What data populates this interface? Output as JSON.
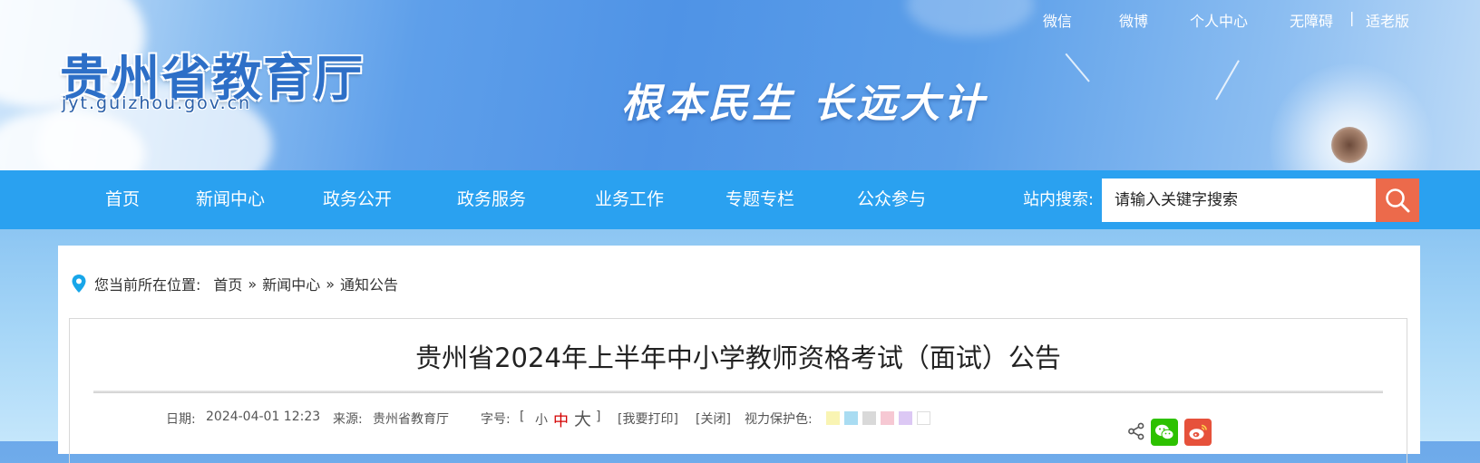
{
  "header": {
    "site_title": "贵州省教育厅",
    "site_url": "jyt.guizhou.gov.cn",
    "slogan": "根本民生 长远大计",
    "top_links": {
      "wechat": "微信",
      "weibo": "微博",
      "personal_center": "个人中心",
      "accessibility": "无障碍",
      "divider": "|",
      "elderly": "适老版"
    }
  },
  "nav": {
    "items": [
      "首页",
      "新闻中心",
      "政务公开",
      "政务服务",
      "业务工作",
      "专题专栏",
      "公众参与"
    ],
    "search_label": "站内搜索:",
    "search_placeholder": "请输入关键字搜索"
  },
  "breadcrumb": {
    "prefix": "您当前所在位置:",
    "items": [
      "首页",
      "新闻中心",
      "通知公告"
    ],
    "separator": "»"
  },
  "article": {
    "title": "贵州省2024年上半年中小学教师资格考试（面试）公告",
    "date_label": "日期:",
    "date_value": "2024-04-01 12:23",
    "source_label": "来源:",
    "source_value": "贵州省教育厅",
    "font_label": "字号:",
    "bracket_open": "[",
    "font_small": "小",
    "font_medium": "中",
    "font_large": "大",
    "bracket_close": "]",
    "print_link": "[我要打印]",
    "close_link": "[关闭]",
    "eye_protect_label": "视力保护色:",
    "eye_colors": [
      "#f9f4b3",
      "#a9dcf2",
      "#d9d9d9",
      "#f6c8d3",
      "#dcc8f4",
      "#ffffff"
    ]
  },
  "colors": {
    "nav_bg": "#2aa1f0",
    "search_button": "#ec6a4b",
    "wechat": "#2dc100",
    "weibo": "#e6513b"
  }
}
